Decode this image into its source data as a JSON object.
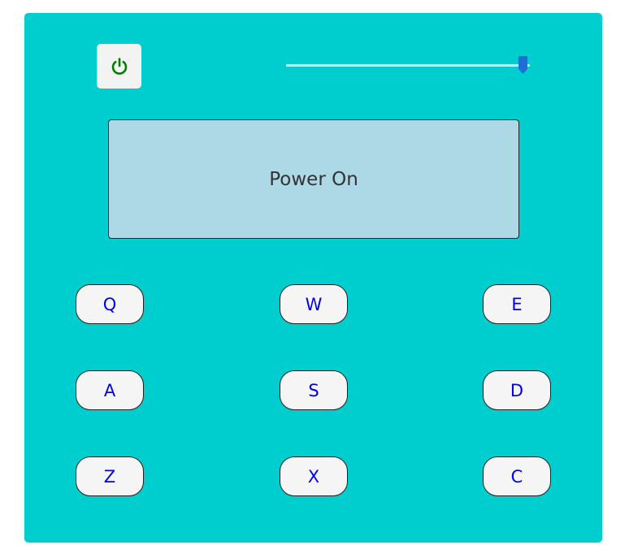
{
  "power": {
    "icon": "power-icon",
    "color": "#008000",
    "state": "on"
  },
  "volume": {
    "value": 0.97,
    "thumb_color": "#1d6fd6"
  },
  "display": {
    "text": "Power On"
  },
  "pads": [
    {
      "key": "Q"
    },
    {
      "key": "W"
    },
    {
      "key": "E"
    },
    {
      "key": "A"
    },
    {
      "key": "S"
    },
    {
      "key": "D"
    },
    {
      "key": "Z"
    },
    {
      "key": "X"
    },
    {
      "key": "C"
    }
  ],
  "colors": {
    "machine_bg": "#00cdcd",
    "display_bg": "#add8e6",
    "pad_text": "#0000ee"
  }
}
